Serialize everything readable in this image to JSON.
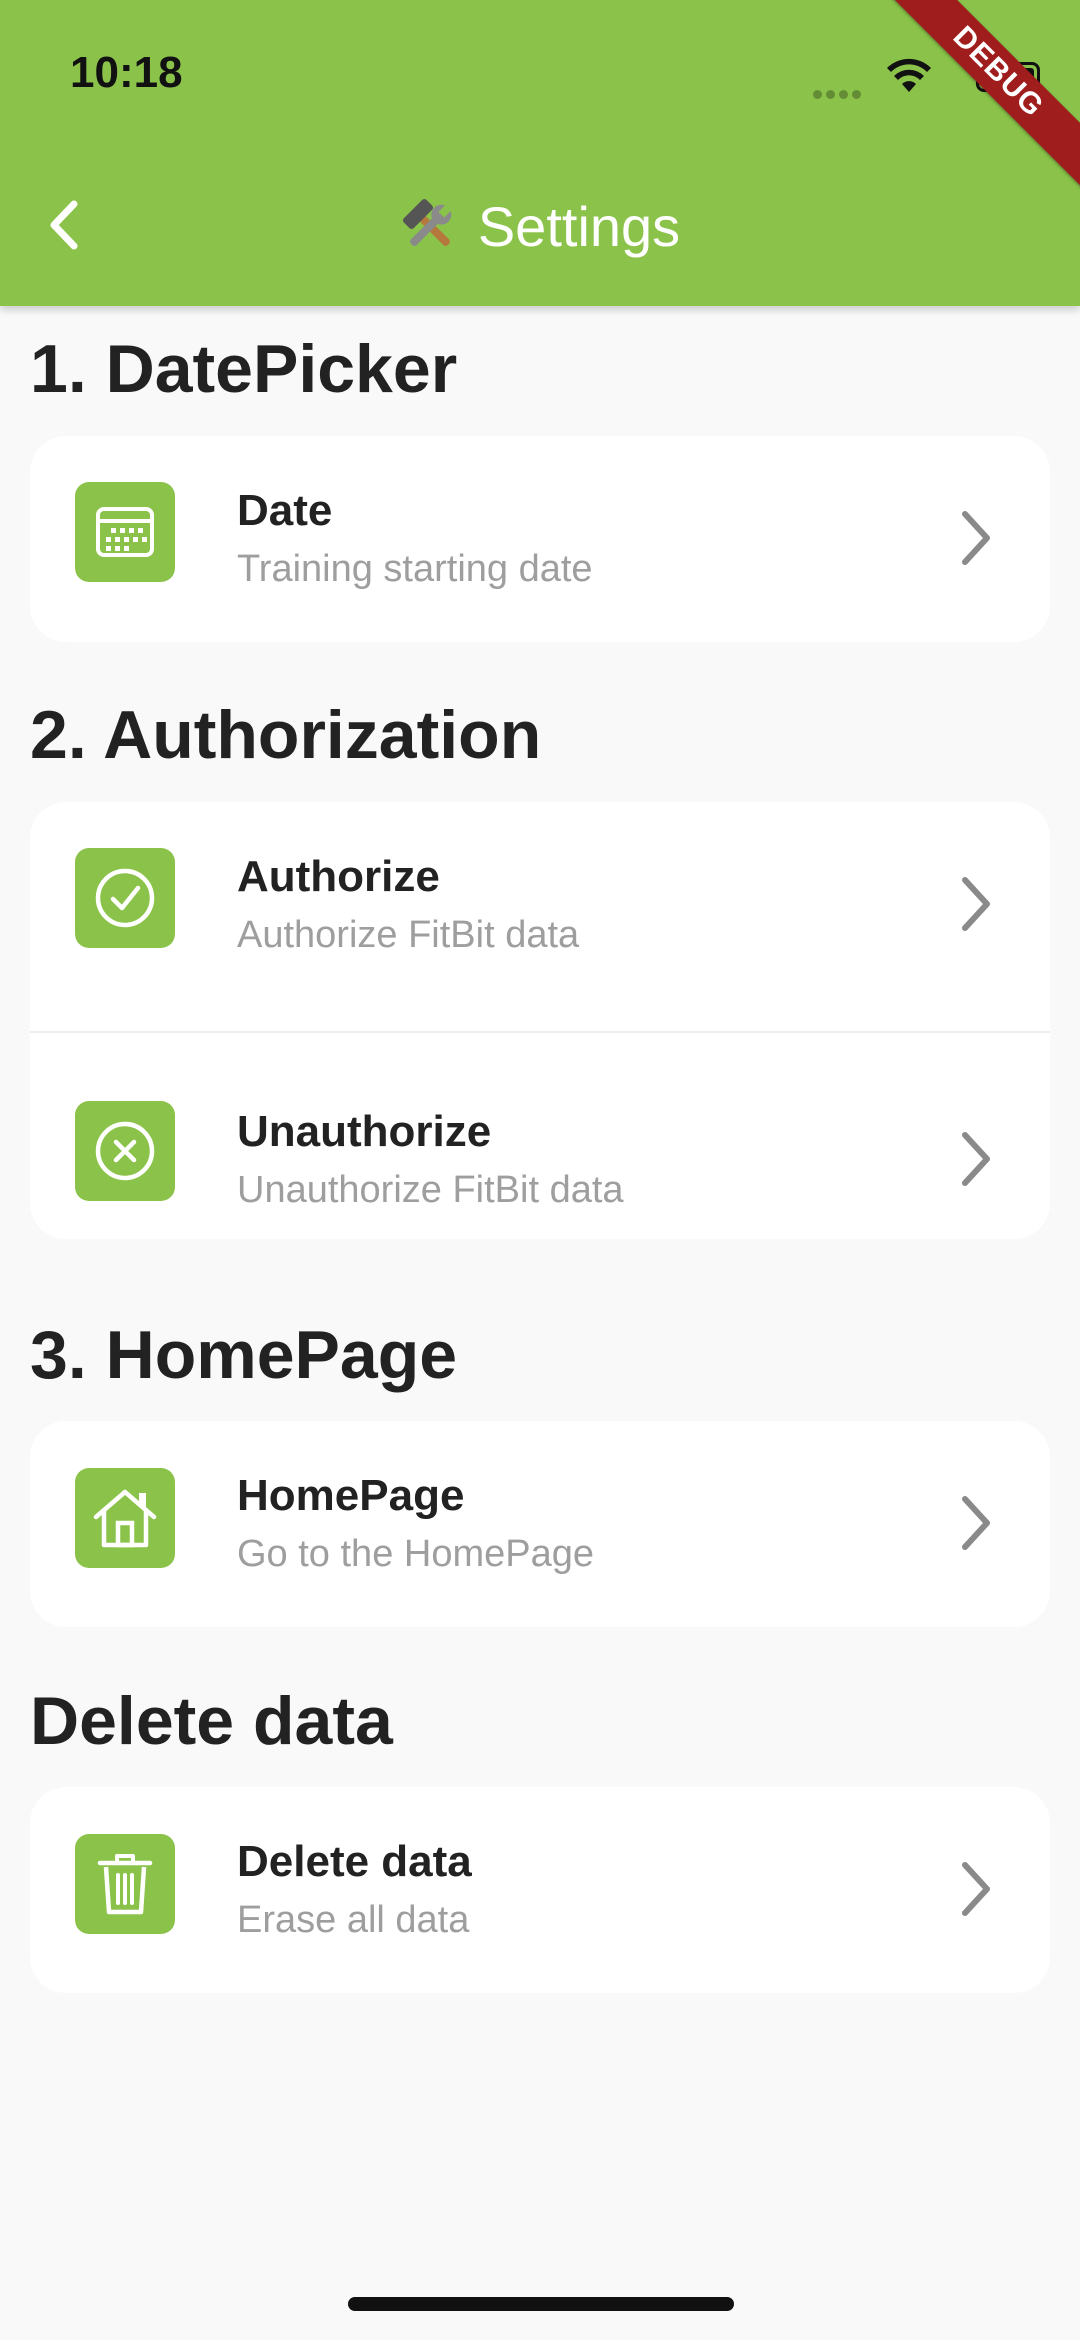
{
  "status_bar": {
    "time": "10:18"
  },
  "debug_banner": "DEBUG",
  "app_bar": {
    "title": "Settings",
    "title_emoji": "hammer-and-wrench"
  },
  "colors": {
    "accent": "#8bc34a",
    "banner": "#a01d1d"
  },
  "sections": [
    {
      "heading": "1. DatePicker",
      "items": [
        {
          "title": "Date",
          "subtitle": "Training starting date",
          "icon": "calendar-icon"
        }
      ]
    },
    {
      "heading": "2. Authorization",
      "items": [
        {
          "title": "Authorize",
          "subtitle": "Authorize FitBit data",
          "icon": "check-circle-icon"
        },
        {
          "title": "Unauthorize",
          "subtitle": "Unauthorize FitBit data",
          "icon": "x-circle-icon"
        }
      ]
    },
    {
      "heading": "3. HomePage",
      "items": [
        {
          "title": "HomePage",
          "subtitle": "Go to the HomePage",
          "icon": "home-icon"
        }
      ]
    },
    {
      "heading": "Delete data",
      "items": [
        {
          "title": "Delete data",
          "subtitle": "Erase all data",
          "icon": "trash-icon"
        }
      ]
    }
  ]
}
